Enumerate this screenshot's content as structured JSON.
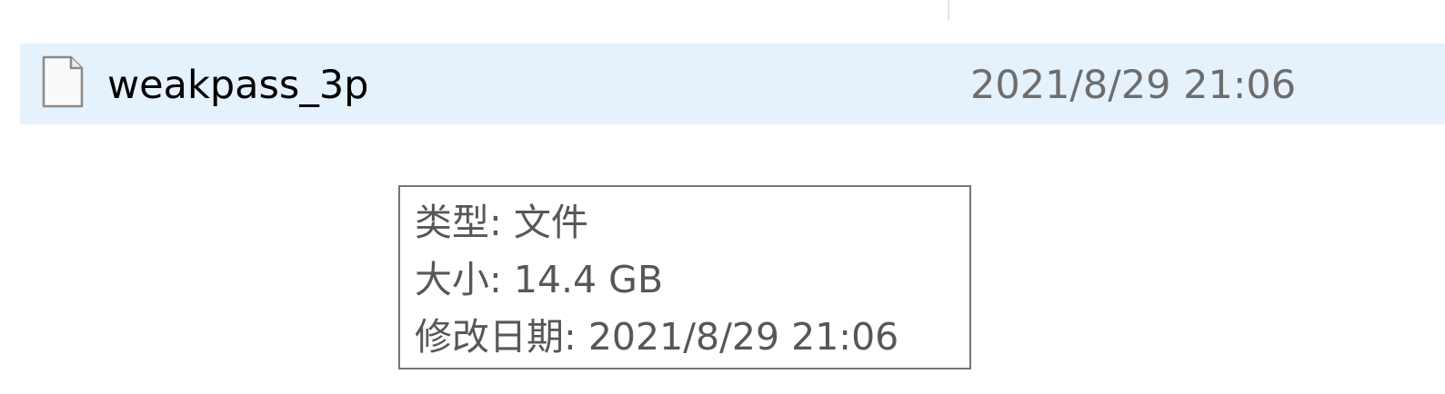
{
  "file_row": {
    "name": "weakpass_3p",
    "date_modified": "2021/8/29 21:06",
    "icon": "generic-file-icon",
    "selection_color": "#e5f1fb"
  },
  "tooltip": {
    "type_line": "类型: 文件",
    "size_line": "大小: 14.4 GB",
    "modified_line": "修改日期: 2021/8/29 21:06"
  }
}
